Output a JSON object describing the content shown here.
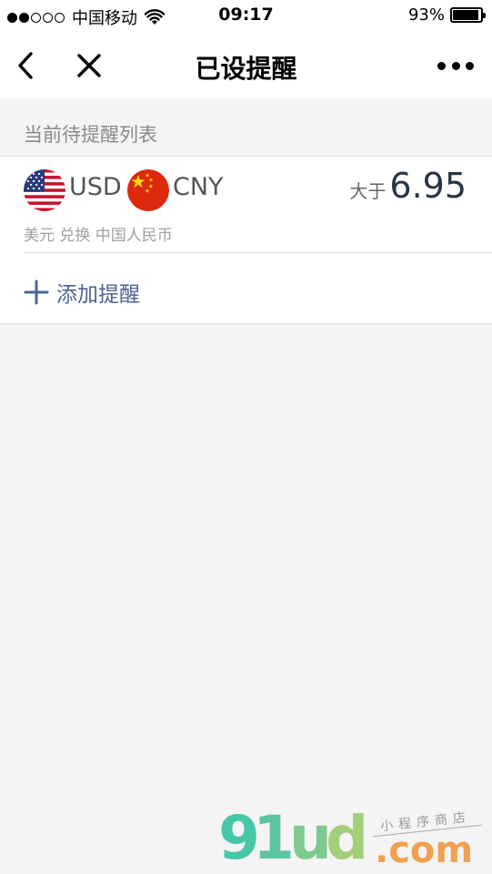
{
  "status_bar": {
    "carrier": "中国移动",
    "time": "09:17",
    "battery_percent": "93%",
    "battery_level": 0.93,
    "signal_bars_filled": 2,
    "signal_bars_total": 5
  },
  "nav": {
    "title": "已设提醒",
    "back_icon": "chevron-left-icon",
    "close_icon": "close-icon",
    "more_icon": "more-dots-icon"
  },
  "section": {
    "header": "当前待提醒列表"
  },
  "alerts": [
    {
      "from_code": "USD",
      "to_code": "CNY",
      "from_flag": "us-flag-icon",
      "to_flag": "cn-flag-icon",
      "condition_label": "大于",
      "condition_value": "6.95",
      "description": "美元 兑换 中国人民币"
    }
  ],
  "add_alert": {
    "label": "添加提醒",
    "icon": "plus-icon"
  },
  "watermark": {
    "brand": "91ud",
    "suffix": ".com",
    "tagline": "小程序商店",
    "colors": [
      "#46c7a8",
      "#5cc4a0",
      "#7ec98f",
      "#a4cf7a",
      "#f0a050"
    ]
  },
  "colors": {
    "link_blue": "#4c6490",
    "value_dark": "#2a3644",
    "muted_text": "#8a8a8a",
    "background": "#f4f4f4"
  }
}
